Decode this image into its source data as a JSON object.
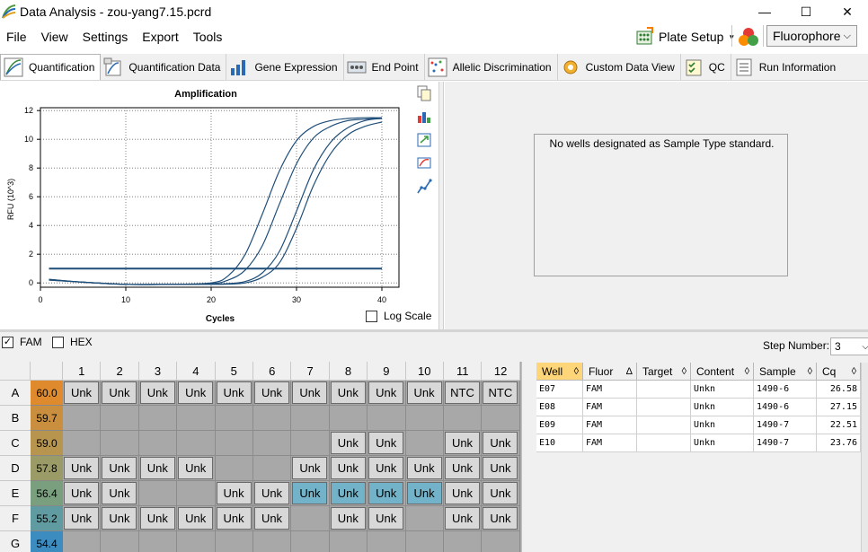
{
  "window": {
    "title": "Data Analysis - zou-yang7.15.pcrd",
    "minimize": "—",
    "maximize": "☐",
    "close": "✕"
  },
  "menu": [
    "File",
    "View",
    "Settings",
    "Export",
    "Tools"
  ],
  "toolbar": {
    "plate_setup": "Plate Setup",
    "fluorophore": "Fluorophore"
  },
  "tabs": [
    "Quantification",
    "Quantification Data",
    "Gene Expression",
    "End Point",
    "Allelic Discrimination",
    "Custom Data View",
    "QC",
    "Run Information"
  ],
  "chart": {
    "title": "Amplification",
    "ylabel": "RFU (10^3)",
    "xlabel": "Cycles",
    "log_scale_label": "Log Scale"
  },
  "chart_data": {
    "type": "line",
    "title": "Amplification",
    "xlabel": "Cycles",
    "ylabel": "RFU (10^3)",
    "xlim": [
      0,
      42
    ],
    "ylim": [
      -0.3,
      12.2
    ],
    "xticks": [
      0,
      10,
      20,
      30,
      40
    ],
    "yticks": [
      0,
      2,
      4,
      6,
      8,
      10,
      12
    ],
    "grid": true,
    "threshold": 1.0,
    "series": [
      {
        "x": [
          1,
          5,
          10,
          15,
          20,
          22,
          24,
          26,
          28,
          30,
          32,
          34,
          36,
          38,
          40
        ],
        "y": [
          0.25,
          0.05,
          -0.1,
          -0.1,
          0.0,
          0.5,
          2.0,
          4.8,
          7.8,
          9.9,
          10.9,
          11.3,
          11.45,
          11.5,
          11.5
        ]
      },
      {
        "x": [
          1,
          5,
          10,
          15,
          20,
          22,
          24,
          26,
          28,
          30,
          32,
          34,
          36,
          38,
          40
        ],
        "y": [
          0.25,
          0.05,
          -0.1,
          -0.1,
          -0.05,
          0.2,
          0.9,
          2.6,
          5.5,
          8.3,
          10.1,
          10.9,
          11.3,
          11.4,
          11.5
        ]
      },
      {
        "x": [
          1,
          5,
          10,
          15,
          20,
          22,
          24,
          26,
          28,
          30,
          32,
          34,
          36,
          38,
          40
        ],
        "y": [
          0.2,
          0.05,
          -0.1,
          -0.1,
          -0.08,
          -0.05,
          0.1,
          0.7,
          2.2,
          5.0,
          7.9,
          9.8,
          10.8,
          11.3,
          11.45
        ]
      },
      {
        "x": [
          1,
          5,
          10,
          15,
          20,
          22,
          24,
          26,
          28,
          30,
          32,
          34,
          36,
          38,
          40
        ],
        "y": [
          0.2,
          0.05,
          -0.1,
          -0.1,
          -0.1,
          -0.08,
          0.0,
          0.4,
          1.4,
          3.8,
          6.8,
          9.0,
          10.3,
          10.9,
          11.2
        ]
      }
    ]
  },
  "standard_msg": "No wells designated as Sample Type standard.",
  "fluors": {
    "fam": "FAM",
    "hex": "HEX",
    "fam_checked": true,
    "hex_checked": false
  },
  "step": {
    "label": "Step Number:",
    "value": "3"
  },
  "plate": {
    "columns": [
      "1",
      "2",
      "3",
      "4",
      "5",
      "6",
      "7",
      "8",
      "9",
      "10",
      "11",
      "12"
    ],
    "rows": [
      {
        "label": "A",
        "temp": "60.0",
        "color": "#e08a2e",
        "wells": [
          "Unk",
          "Unk",
          "Unk",
          "Unk",
          "Unk",
          "Unk",
          "Unk",
          "Unk",
          "Unk",
          "Unk",
          "NTC",
          "NTC"
        ],
        "sel": []
      },
      {
        "label": "B",
        "temp": "59.7",
        "color": "#c98f3e",
        "wells": [
          "",
          "",
          "",
          "",
          "",
          "",
          "",
          "",
          "",
          "",
          "",
          ""
        ],
        "sel": []
      },
      {
        "label": "C",
        "temp": "59.0",
        "color": "#b7954f",
        "wells": [
          "",
          "",
          "",
          "",
          "",
          "",
          "",
          "Unk",
          "Unk",
          "",
          "Unk",
          "Unk"
        ],
        "sel": []
      },
      {
        "label": "D",
        "temp": "57.8",
        "color": "#9a9b66",
        "wells": [
          "Unk",
          "Unk",
          "Unk",
          "Unk",
          "",
          "",
          "Unk",
          "Unk",
          "Unk",
          "Unk",
          "Unk",
          "Unk"
        ],
        "sel": []
      },
      {
        "label": "E",
        "temp": "56.4",
        "color": "#7a9f7f",
        "wells": [
          "Unk",
          "Unk",
          "",
          "",
          "Unk",
          "Unk",
          "Unk",
          "Unk",
          "Unk",
          "Unk",
          "Unk",
          "Unk"
        ],
        "sel": [
          6,
          7,
          8,
          9
        ]
      },
      {
        "label": "F",
        "temp": "55.2",
        "color": "#5f9ba0",
        "wells": [
          "Unk",
          "Unk",
          "Unk",
          "Unk",
          "Unk",
          "Unk",
          "",
          "Unk",
          "Unk",
          "",
          "Unk",
          "Unk"
        ],
        "sel": []
      },
      {
        "label": "G",
        "temp": "54.4",
        "color": "#3c8cc0",
        "wells": [
          "",
          "",
          "",
          "",
          "",
          "",
          "",
          "",
          "",
          "",
          "",
          ""
        ],
        "sel": []
      }
    ]
  },
  "results": {
    "headers": [
      "Well",
      "Fluor",
      "Target",
      "Content",
      "Sample",
      "Cq"
    ],
    "sort_marks": [
      "◊",
      "",
      "◊",
      "◊",
      "◊",
      "◊"
    ],
    "fluor_sort": "Δ",
    "rows": [
      [
        "E07",
        "FAM",
        "",
        "Unkn",
        "1490-6",
        "26.58"
      ],
      [
        "E08",
        "FAM",
        "",
        "Unkn",
        "1490-6",
        "27.15"
      ],
      [
        "E09",
        "FAM",
        "",
        "Unkn",
        "1490-7",
        "22.51"
      ],
      [
        "E10",
        "FAM",
        "",
        "Unkn",
        "1490-7",
        "23.76"
      ]
    ]
  },
  "colors": {
    "curve": "#1f4e79",
    "threshold": "#1f4e79",
    "well_selected": "#73b3c9",
    "well_header": "#ffd57a"
  }
}
